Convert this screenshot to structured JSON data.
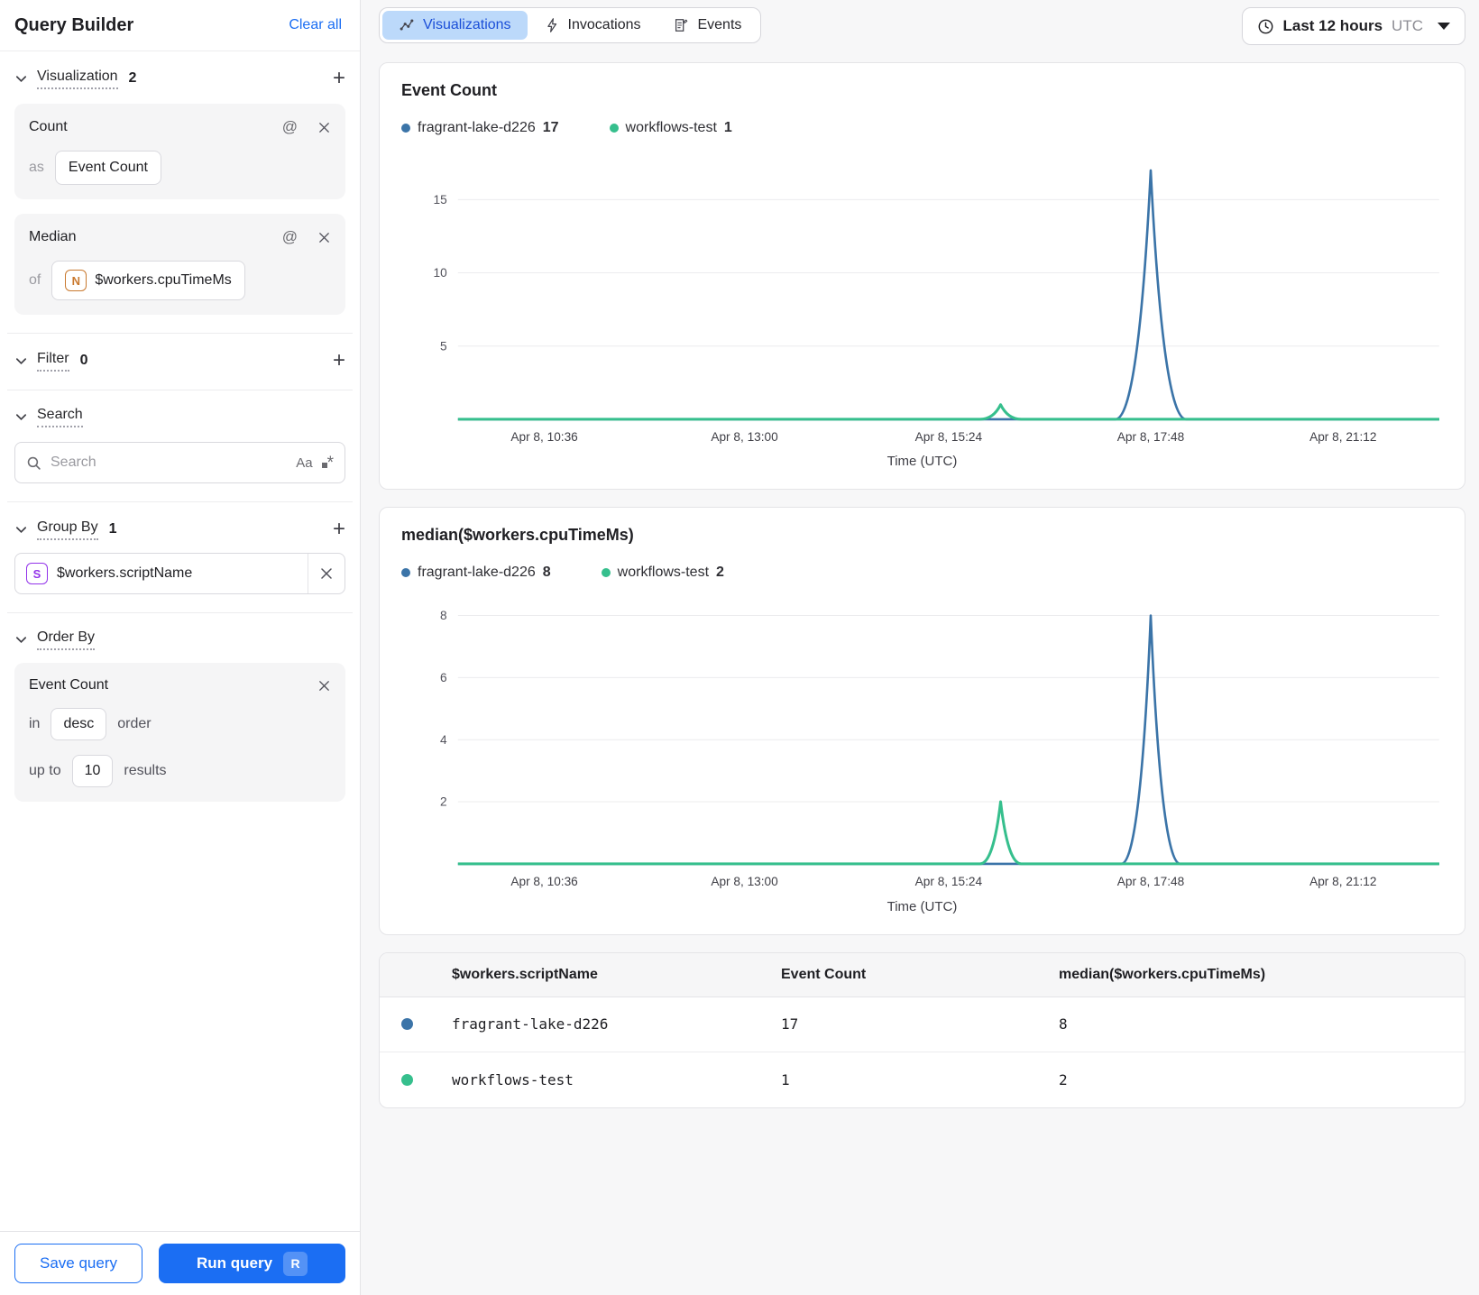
{
  "sidebar": {
    "title": "Query Builder",
    "clear_all_label": "Clear all",
    "sections": {
      "visualization": {
        "label": "Visualization",
        "count": "2"
      },
      "filter": {
        "label": "Filter",
        "count": "0"
      },
      "search": {
        "label": "Search"
      },
      "group_by": {
        "label": "Group By",
        "count": "1"
      },
      "order_by": {
        "label": "Order By"
      }
    },
    "viz_cards": [
      {
        "title": "Count",
        "prefix": "as",
        "value": "Event Count"
      },
      {
        "title": "Median",
        "prefix": "of",
        "badge_letter": "N",
        "value": "$workers.cpuTimeMs"
      }
    ],
    "search_input": {
      "placeholder": "Search",
      "case_toggle": "Aa"
    },
    "group_by_items": [
      {
        "badge_letter": "S",
        "value": "$workers.scriptName"
      }
    ],
    "order_by_card": {
      "field": "Event Count",
      "in_label": "in",
      "direction": "desc",
      "order_label": "order",
      "upto_label": "up to",
      "limit": "10",
      "results_label": "results"
    },
    "footer": {
      "save_label": "Save query",
      "run_label": "Run query",
      "run_shortcut": "R"
    }
  },
  "topbar": {
    "tabs": [
      {
        "label": "Visualizations"
      },
      {
        "label": "Invocations"
      },
      {
        "label": "Events"
      }
    ],
    "active_tab": "Visualizations",
    "time_range": {
      "label": "Last 12 hours",
      "timezone": "UTC"
    }
  },
  "chart_data": [
    {
      "type": "line",
      "title": "Event Count",
      "xlabel": "Time (UTC)",
      "x_ticks": [
        "Apr 8, 10:36",
        "Apr 8, 13:00",
        "Apr 8, 15:24",
        "Apr 8, 17:48",
        "Apr 8, 21:12"
      ],
      "x_tick_fracs": [
        0.088,
        0.292,
        0.5,
        0.706,
        0.902
      ],
      "y_ticks": [
        5,
        10,
        15
      ],
      "ylim": [
        0,
        17.6
      ],
      "grid": true,
      "legend_position": "top",
      "series": [
        {
          "name": "fragrant-lake-d226",
          "color": "#3b74a8",
          "legend_value": "17",
          "baseline": 0,
          "spike": {
            "time": "Apr 8, 17:48",
            "x_frac": 0.706,
            "peak": 17,
            "half_width_frac": 0.036
          }
        },
        {
          "name": "workflows-test",
          "color": "#36bf8d",
          "legend_value": "1",
          "baseline": 0,
          "spike": {
            "time": "Apr 8, 16:00",
            "x_frac": 0.553,
            "peak": 1,
            "half_width_frac": 0.021
          }
        }
      ]
    },
    {
      "type": "line",
      "title": "median($workers.cpuTimeMs)",
      "xlabel": "Time (UTC)",
      "x_ticks": [
        "Apr 8, 10:36",
        "Apr 8, 13:00",
        "Apr 8, 15:24",
        "Apr 8, 17:48",
        "Apr 8, 21:12"
      ],
      "x_tick_fracs": [
        0.088,
        0.292,
        0.5,
        0.706,
        0.902
      ],
      "y_ticks": [
        2,
        4,
        6,
        8
      ],
      "ylim": [
        0,
        8.3
      ],
      "grid": true,
      "legend_position": "top",
      "series": [
        {
          "name": "fragrant-lake-d226",
          "color": "#3b74a8",
          "legend_value": "8",
          "baseline": 0,
          "spike": {
            "time": "Apr 8, 17:48",
            "x_frac": 0.706,
            "peak": 8,
            "half_width_frac": 0.03
          }
        },
        {
          "name": "workflows-test",
          "color": "#36bf8d",
          "legend_value": "2",
          "baseline": 0,
          "spike": {
            "time": "Apr 8, 16:00",
            "x_frac": 0.553,
            "peak": 2,
            "half_width_frac": 0.021
          }
        }
      ]
    }
  ],
  "table": {
    "headers": [
      "$workers.scriptName",
      "Event Count",
      "median($workers.cpuTimeMs)"
    ],
    "rows": [
      {
        "color": "#3b74a8",
        "name": "fragrant-lake-d226",
        "event_count": "17",
        "median": "8"
      },
      {
        "color": "#36bf8d",
        "name": "workflows-test",
        "event_count": "1",
        "median": "2"
      }
    ]
  }
}
